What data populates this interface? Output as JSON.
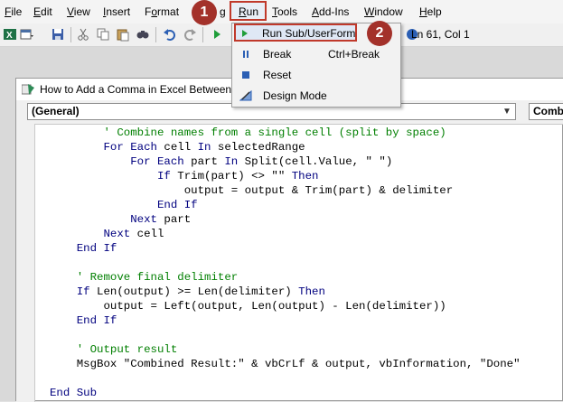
{
  "menubar": {
    "items": [
      {
        "pre": "",
        "ul": "F",
        "post": "ile"
      },
      {
        "pre": "",
        "ul": "E",
        "post": "dit"
      },
      {
        "pre": "",
        "ul": "V",
        "post": "iew"
      },
      {
        "pre": "",
        "ul": "I",
        "post": "nsert"
      },
      {
        "pre": "F",
        "ul": "o",
        "post": "rmat"
      },
      {
        "pre": "",
        "ul": "",
        "post": "g"
      },
      {
        "pre": "",
        "ul": "R",
        "post": "un"
      },
      {
        "pre": "",
        "ul": "T",
        "post": "ools"
      },
      {
        "pre": "",
        "ul": "A",
        "post": "dd-Ins"
      },
      {
        "pre": "",
        "ul": "W",
        "post": "indow"
      },
      {
        "pre": "",
        "ul": "H",
        "post": "elp"
      }
    ]
  },
  "status": {
    "position": "Ln 61, Col 1"
  },
  "run_menu": {
    "items": [
      {
        "label": "Run Sub/UserForm",
        "shortcut": "",
        "icon": "play-icon"
      },
      {
        "label": "Break",
        "shortcut": "Ctrl+Break",
        "icon": "pause-icon"
      },
      {
        "label": "Reset",
        "shortcut": "",
        "icon": "stop-icon"
      },
      {
        "label": "Design Mode",
        "shortcut": "",
        "icon": "design-mode-icon"
      }
    ]
  },
  "badges": {
    "one": "1",
    "two": "2"
  },
  "codewindow": {
    "title": "How to Add a Comma in Excel Between",
    "object_combo": "(General)",
    "proc_combo": "Combi"
  },
  "code_lines": [
    {
      "indent": "        ",
      "parts": [
        {
          "t": "' Combine names from a single cell (split by space)",
          "c": "cm"
        }
      ]
    },
    {
      "indent": "        ",
      "parts": [
        {
          "t": "For Each",
          "c": "kw"
        },
        {
          "t": " cell ",
          "c": ""
        },
        {
          "t": "In",
          "c": "kw"
        },
        {
          "t": " selectedRange",
          "c": ""
        }
      ]
    },
    {
      "indent": "            ",
      "parts": [
        {
          "t": "For Each",
          "c": "kw"
        },
        {
          "t": " part ",
          "c": ""
        },
        {
          "t": "In",
          "c": "kw"
        },
        {
          "t": " Split(cell.Value, \" \")",
          "c": ""
        }
      ]
    },
    {
      "indent": "                ",
      "parts": [
        {
          "t": "If",
          "c": "kw"
        },
        {
          "t": " Trim(part) <> \"\" ",
          "c": ""
        },
        {
          "t": "Then",
          "c": "kw"
        }
      ]
    },
    {
      "indent": "                    ",
      "parts": [
        {
          "t": "output = output & Trim(part) & delimiter",
          "c": ""
        }
      ]
    },
    {
      "indent": "                ",
      "parts": [
        {
          "t": "End If",
          "c": "kw"
        }
      ]
    },
    {
      "indent": "            ",
      "parts": [
        {
          "t": "Next",
          "c": "kw"
        },
        {
          "t": " part",
          "c": ""
        }
      ]
    },
    {
      "indent": "        ",
      "parts": [
        {
          "t": "Next",
          "c": "kw"
        },
        {
          "t": " cell",
          "c": ""
        }
      ]
    },
    {
      "indent": "    ",
      "parts": [
        {
          "t": "End If",
          "c": "kw"
        }
      ]
    },
    {
      "indent": "",
      "parts": []
    },
    {
      "indent": "    ",
      "parts": [
        {
          "t": "' Remove final delimiter",
          "c": "cm"
        }
      ]
    },
    {
      "indent": "    ",
      "parts": [
        {
          "t": "If",
          "c": "kw"
        },
        {
          "t": " Len(output) >= Len(delimiter) ",
          "c": ""
        },
        {
          "t": "Then",
          "c": "kw"
        }
      ]
    },
    {
      "indent": "        ",
      "parts": [
        {
          "t": "output = Left(output, Len(output) - Len(delimiter))",
          "c": ""
        }
      ]
    },
    {
      "indent": "    ",
      "parts": [
        {
          "t": "End If",
          "c": "kw"
        }
      ]
    },
    {
      "indent": "",
      "parts": []
    },
    {
      "indent": "    ",
      "parts": [
        {
          "t": "' Output result",
          "c": "cm"
        }
      ]
    },
    {
      "indent": "    ",
      "parts": [
        {
          "t": "MsgBox \"Combined Result:\" & vbCrLf & output, vbInformation, \"Done\"",
          "c": ""
        }
      ]
    },
    {
      "indent": "",
      "parts": []
    },
    {
      "indent": "",
      "parts": [
        {
          "t": "End Sub",
          "c": "kw"
        }
      ]
    }
  ]
}
